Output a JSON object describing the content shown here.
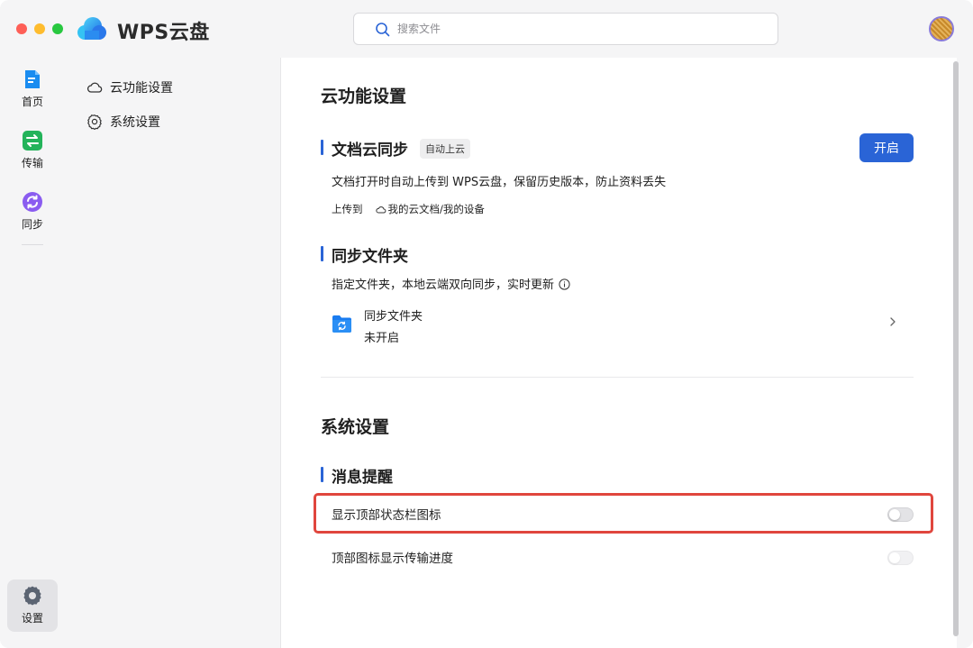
{
  "app": {
    "title": "WPS云盘",
    "brand_color": "#2a64d6"
  },
  "search": {
    "placeholder": "搜索文件",
    "icon": "search-icon"
  },
  "rail": {
    "items": [
      {
        "label": "首页",
        "icon": "home-doc-icon",
        "color": "#1a8cf0"
      },
      {
        "label": "传输",
        "icon": "transfer-icon",
        "color": "#23b35a"
      },
      {
        "label": "同步",
        "icon": "sync-icon",
        "color": "#8a5cf0"
      },
      {
        "label": "设置",
        "icon": "gear-icon",
        "active": true
      }
    ]
  },
  "settings_nav": {
    "items": [
      {
        "label": "云功能设置",
        "icon": "cloud-icon"
      },
      {
        "label": "系统设置",
        "icon": "gear-icon"
      }
    ]
  },
  "cloud_section": {
    "title": "云功能设置",
    "doc_sync": {
      "title": "文档云同步",
      "tag": "自动上云",
      "button": "开启",
      "description": "文档打开时自动上传到 WPS云盘，保留历史版本，防止资料丢失",
      "upload_to_label": "上传到",
      "upload_path": "我的云文档/我的设备"
    },
    "sync_folder": {
      "title": "同步文件夹",
      "description": "指定文件夹，本地云端双向同步，实时更新",
      "row_title": "同步文件夹",
      "row_status": "未开启"
    }
  },
  "system_section": {
    "title": "系统设置",
    "notifications": {
      "title": "消息提醒",
      "items": [
        {
          "label": "显示顶部状态栏图标",
          "enabled": false
        },
        {
          "label": "顶部图标显示传输进度",
          "enabled": false
        }
      ]
    }
  },
  "colors": {
    "highlight_box": "#e0463d",
    "accent": "#2a64d6"
  }
}
